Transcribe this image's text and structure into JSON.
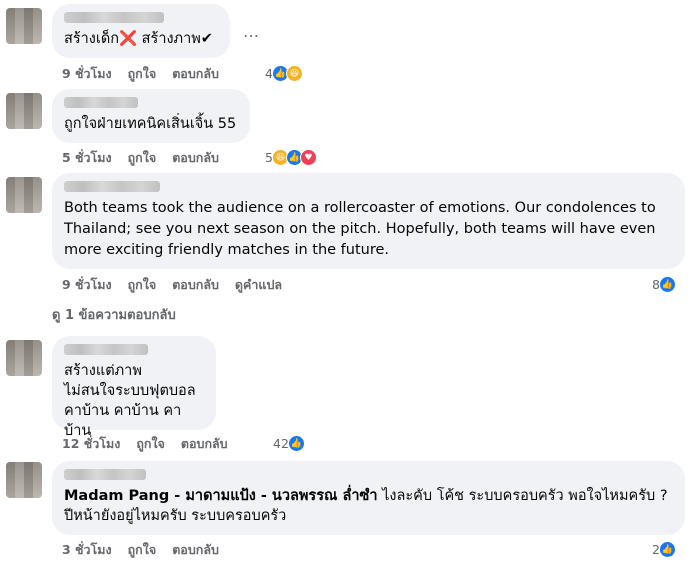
{
  "comments": [
    {
      "text": "สร้างเด็ก❌ สร้างภาพ✔",
      "more": "…",
      "time": "9 ชั่วโมง",
      "like": "ถูกใจ",
      "reply": "ตอบกลับ",
      "reaction_count": "4",
      "reactions": [
        "like-icon",
        "haha-icon"
      ]
    },
    {
      "text": "ถูกใจฝ่ายเทคนิคเสิ่นเจิ้น 55",
      "time": "5 ชั่วโมง",
      "like": "ถูกใจ",
      "reply": "ตอบกลับ",
      "reaction_count": "5",
      "reactions": [
        "haha-icon",
        "like-icon",
        "love-icon"
      ]
    },
    {
      "text": "Both teams took the audience on a rollercoaster of emotions. Our condolences to Thailand; see you next season on the pitch. Hopefully, both teams will have even more exciting friendly matches in the future.",
      "time": "9 ชั่วโมง",
      "like": "ถูกใจ",
      "reply": "ตอบกลับ",
      "translate": "ดูคำแปล",
      "reaction_count": "8",
      "reactions": [
        "like-icon"
      ],
      "view_replies": "ดู 1 ข้อความตอบกลับ"
    },
    {
      "text_lines": [
        "สร้างแต่ภาพ",
        "ไม่สนใจระบบฟุตบอล",
        "คาบ้าน คาบ้าน คาบ้าน"
      ],
      "time": "12 ชั่วโมง",
      "like": "ถูกใจ",
      "reply": "ตอบกลับ",
      "reaction_count": "42",
      "reactions": [
        "like-icon"
      ]
    },
    {
      "mention": "Madam Pang - มาดามแป้ง - นวลพรรณ ล่ำซำ",
      "text_rest": " ไงละคับ โค้ช ระบบครอบครัว พอใจไหมครับ ?",
      "text_line2": "ปีหน้ายังอยู่ไหมครับ ระบบครอบครัว",
      "time": "3 ชั่วโมง",
      "like": "ถูกใจ",
      "reply": "ตอบกลับ",
      "reaction_count": "2",
      "reactions": [
        "like-icon"
      ]
    }
  ],
  "colors": {
    "like": "#1877f2",
    "haha": "#f7b125",
    "love": "#f33e58",
    "bubble": "#f0f2f5",
    "meta": "#65676b"
  }
}
